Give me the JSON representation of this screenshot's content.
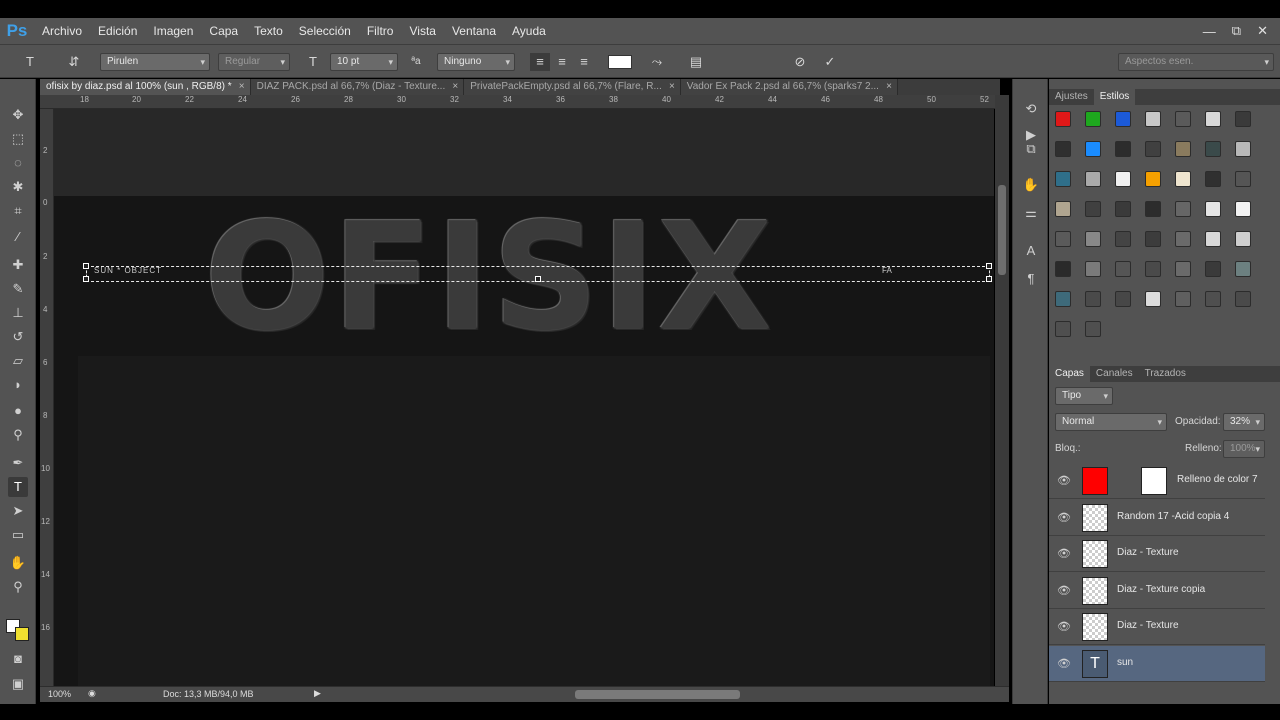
{
  "app": {
    "logo": "Ps"
  },
  "menu": [
    "Archivo",
    "Edición",
    "Imagen",
    "Capa",
    "Texto",
    "Selección",
    "Filtro",
    "Vista",
    "Ventana",
    "Ayuda"
  ],
  "window_controls": {
    "minimize": "—",
    "restore": "⧉",
    "close": "✕"
  },
  "options": {
    "font_family": "Pirulen",
    "font_style": "Regular",
    "font_size": "10 pt",
    "aa_label": "ªa",
    "antialias": "Ninguno",
    "workspace": "Aspectos esen."
  },
  "tabs": [
    {
      "label": "ofisix by diaz.psd al 100% (sun , RGB/8) *",
      "active": true
    },
    {
      "label": "DIAZ PACK.psd al 66,7% (Diaz - Texture...",
      "active": false
    },
    {
      "label": "PrivatePackEmpty.psd al 66,7% (Flare, R...",
      "active": false
    },
    {
      "label": "Vador Ex Pack 2.psd al 66,7% (sparks7 2...",
      "active": false
    }
  ],
  "ruler_top": [
    "18",
    "20",
    "22",
    "24",
    "26",
    "28",
    "30",
    "32",
    "34",
    "36",
    "38",
    "40",
    "42",
    "44",
    "46",
    "48",
    "50",
    "52"
  ],
  "ruler_left": [
    "2",
    "0",
    "2",
    "4",
    "6",
    "8",
    "10",
    "12",
    "14",
    "16"
  ],
  "canvas": {
    "logo_text": "OFISIX",
    "text_left": "SUN * OBJECT",
    "text_right": "FA"
  },
  "status": {
    "zoom": "100%",
    "doc": "Doc: 13,3 MB/94,0 MB"
  },
  "panels": {
    "top_tabs": [
      "Ajustes",
      "Estilos"
    ],
    "active_top": "Estilos",
    "layers_tabs": [
      "Capas",
      "Canales",
      "Trazados"
    ],
    "filter_kind": "Tipo",
    "blend_mode": "Normal",
    "opacity_label": "Opacidad:",
    "opacity": "32%",
    "lock_label": "Bloq.:",
    "fill_label": "Relleno:",
    "fill": "100%"
  },
  "swatch_colors": [
    "#e01818",
    "#1ea81e",
    "#1c5ad8",
    "#c8c8c8",
    "#5a5a5a",
    "#d8d8d8",
    "#3a3a3a",
    "#2f2f2f",
    "#1a8cff",
    "#2c2c2c",
    "#404040",
    "#8a7b5e",
    "#3a4a4a",
    "#b8b8b8",
    "#2f6f8a",
    "#aaaaaa",
    "#f0f0f0",
    "#f5a000",
    "#efe5cf",
    "#303030",
    "#555555",
    "#b0a590",
    "#404040",
    "#3a3a3a",
    "#2c2c2c",
    "#666666",
    "#e5e5e5",
    "#f2f2f2",
    "#5a5a5a",
    "#888888",
    "#444444",
    "#3c3c3c",
    "#6a6a6a",
    "#d8d8d8",
    "#cfcfcf",
    "#2a2a2a",
    "#7a7a7a",
    "#555555",
    "#4a4a4a",
    "#6a6a6a",
    "#3a3a3a",
    "#6c8080",
    "#3e6a7a",
    "#4a4a4a",
    "#474747",
    "#dcdcdc",
    "#5f5f5f",
    "#4f4f4f",
    "#4a4a4a",
    "#4f4f4f",
    "#4f4f4f"
  ],
  "layers": [
    {
      "name": "Relleno de color 7",
      "type": "fill",
      "fill_color": "#ff0000",
      "selected": false
    },
    {
      "name": "Random 17 -Acid copia 4",
      "type": "pixel",
      "selected": false
    },
    {
      "name": "Diaz - Texture",
      "type": "pixel",
      "selected": false
    },
    {
      "name": "Diaz - Texture copia",
      "type": "pixel",
      "selected": false
    },
    {
      "name": "Diaz - Texture",
      "type": "pixel",
      "selected": false
    },
    {
      "name": "sun",
      "type": "text",
      "selected": true
    }
  ]
}
